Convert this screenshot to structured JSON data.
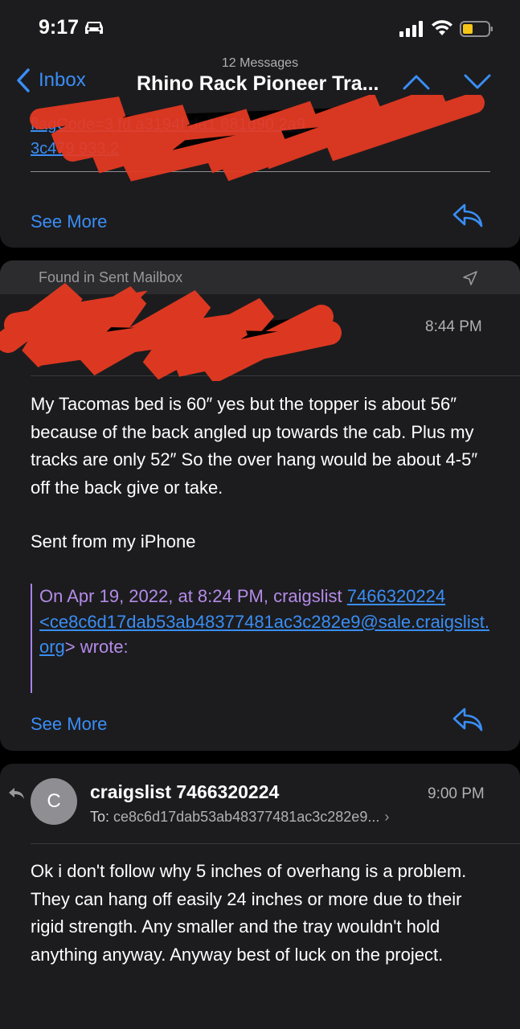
{
  "status": {
    "time": "9:17"
  },
  "nav": {
    "back_label": "Inbox",
    "message_count": "12 Messages",
    "title": "Rhino Rack Pioneer Tra..."
  },
  "card1": {
    "link_line1": "flagCode=3    fd    a3194f    da1    881d90    2a9",
    "link_line2": "3c479    933.2",
    "see_more": "See More"
  },
  "card2": {
    "found_label": "Found in Sent Mailbox",
    "time": "8:44 PM",
    "body": "My Tacomas bed is 60″ yes but the topper is about 56″ because of the back angled up towards the cab. Plus my tracks are only 52″ So the over hang would be about 4-5″ off the back give or take.",
    "signature": "Sent from my iPhone",
    "quote_prefix": "On Apr 19, 2022, at 8:24 PM, craigslist ",
    "quote_phone": "7466320224",
    "quote_email": "<ce8c6d17dab53ab48377481ac3c282e9@sale.craigslist.org",
    "quote_suffix": "> wrote:",
    "see_more": "See More"
  },
  "card3": {
    "avatar_letter": "C",
    "sender": "craigslist 7466320224",
    "time": "9:00 PM",
    "to_label": "To:",
    "to_value": "ce8c6d17dab53ab48377481ac3c282e9...",
    "body": "Ok i don't follow why 5 inches of overhang is a problem. They can hang off easily 24  inches or more due to their rigid strength. Any smaller and the tray wouldn't hold anything anyway.  Anyway best of luck on the project."
  },
  "colors": {
    "accent": "#3a8ef6",
    "quote": "#b48be8",
    "redaction": "#e83a22"
  }
}
